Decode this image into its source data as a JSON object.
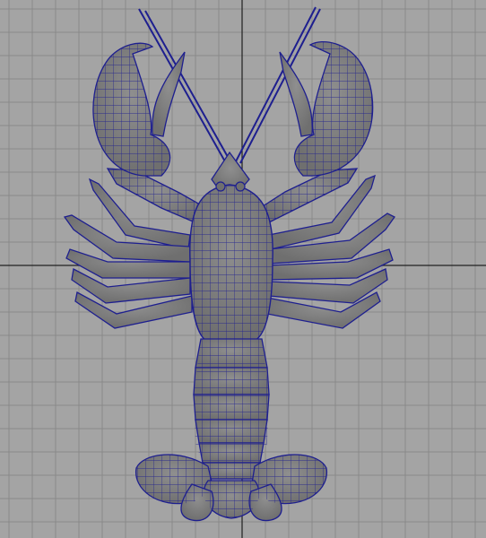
{
  "viewport": {
    "background_color": "#a4a4a4",
    "grid_line_color": "#8a8a8a",
    "axis_line_color": "#202020",
    "grid_visible": true
  },
  "model": {
    "shading_color": "#7b7b7b",
    "shading_highlight": "#9a9a9a",
    "wireframe_color": "#1e1f8f",
    "display_mode": "wireframe-on-shaded"
  }
}
